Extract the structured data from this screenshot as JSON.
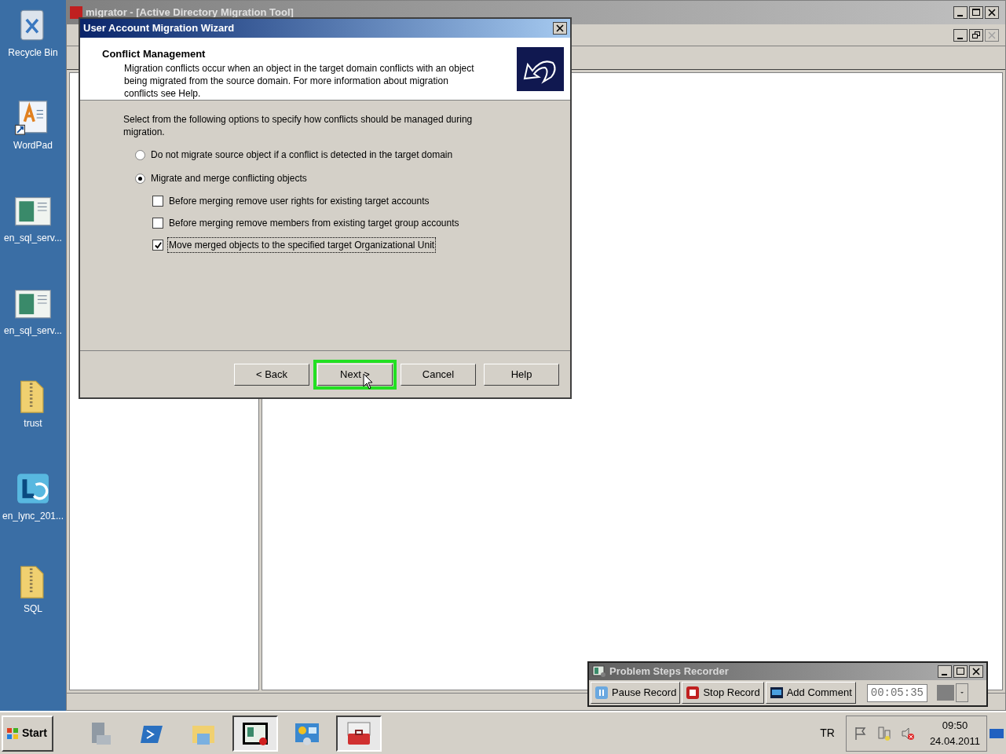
{
  "desktop_icons": [
    {
      "label": "Recycle Bin",
      "kind": "recycle"
    },
    {
      "label": "WordPad",
      "kind": "wordpad"
    },
    {
      "label": "en_sql_serv...",
      "kind": "window"
    },
    {
      "label": "en_sql_serv...",
      "kind": "window"
    },
    {
      "label": "trust",
      "kind": "zip"
    },
    {
      "label": "en_lync_201...",
      "kind": "lync"
    },
    {
      "label": "SQL",
      "kind": "zip"
    }
  ],
  "main_window": {
    "title": "migrator - [Active Directory Migration Tool]"
  },
  "dialog": {
    "title": "User Account Migration Wizard",
    "header_title": "Conflict Management",
    "header_description": "Migration conflicts occur when an object in the target domain conflicts with an object being migrated from the source domain. For more information about migration conflicts see Help.",
    "instruction": "Select from the following options to specify how conflicts should be managed during migration.",
    "options": [
      {
        "kind": "radio",
        "label": "Do not migrate source object if a conflict is detected in the target domain",
        "selected": false
      },
      {
        "kind": "radio",
        "label": "Migrate and merge conflicting objects",
        "selected": true,
        "children": [
          {
            "kind": "checkbox",
            "label": "Before merging remove user rights for existing target accounts",
            "checked": false,
            "focused": false
          },
          {
            "kind": "checkbox",
            "label": "Before merging remove members from existing target group accounts",
            "checked": false,
            "focused": false
          },
          {
            "kind": "checkbox",
            "label": "Move merged objects to the specified target Organizational Unit",
            "checked": true,
            "focused": true
          }
        ]
      }
    ],
    "buttons": [
      {
        "label": "< Back",
        "highlighted": false
      },
      {
        "label": "Next >",
        "highlighted": true
      },
      {
        "label": "Cancel",
        "highlighted": false
      },
      {
        "label": "Help",
        "highlighted": false
      }
    ]
  },
  "recorder": {
    "title": "Problem Steps Recorder",
    "buttons": [
      {
        "label": "Pause Record",
        "kind": "pause"
      },
      {
        "label": "Stop Record",
        "kind": "stop"
      },
      {
        "label": "Add Comment",
        "kind": "comment"
      }
    ],
    "timer": "00:05:35"
  },
  "taskbar": {
    "start": "Start",
    "apps": [
      {
        "kind": "server",
        "selected": false
      },
      {
        "kind": "shell",
        "selected": false
      },
      {
        "kind": "folder",
        "selected": false
      },
      {
        "kind": "recorder",
        "selected": true
      },
      {
        "kind": "panel",
        "selected": false
      },
      {
        "kind": "toolbox",
        "selected": true
      }
    ],
    "language": "TR",
    "time": "09:50",
    "date": "24.04.2011"
  }
}
